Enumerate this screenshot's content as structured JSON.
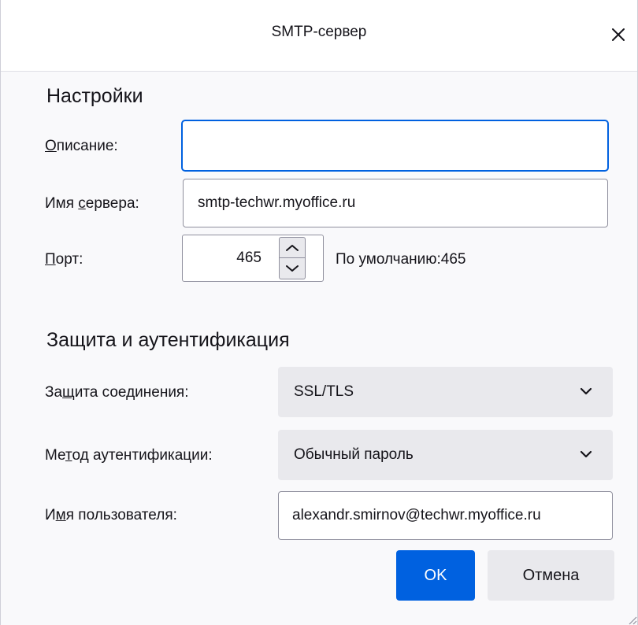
{
  "window": {
    "title": "SMTP-сервер"
  },
  "settings": {
    "section_title": "Настройки",
    "description": {
      "label_accel": "О",
      "label_rest": "писание:",
      "value": ""
    },
    "server_name": {
      "label_before": "Имя ",
      "label_accel": "с",
      "label_rest": "ервера:",
      "value": "smtp-techwr.myoffice.ru"
    },
    "port": {
      "label_accel": "П",
      "label_rest": "орт:",
      "value": "465",
      "default_text": "По умолчанию:465"
    }
  },
  "security": {
    "section_title": "Защита и аутентификация",
    "connection_security": {
      "label_before": "За",
      "label_accel": "щ",
      "label_rest": "ита соединения:",
      "selected": "SSL/TLS"
    },
    "auth_method": {
      "label_before": "Ме",
      "label_accel": "т",
      "label_rest": "од аутентификации:",
      "selected": "Обычный пароль"
    },
    "username": {
      "label_before": "И",
      "label_accel": "м",
      "label_rest": "я пользователя:",
      "value": "alexandr.smirnov@techwr.myoffice.ru"
    }
  },
  "buttons": {
    "ok": "OK",
    "cancel": "Отмена"
  },
  "colors": {
    "accent": "#0061e0",
    "button_bg": "#e9e9ed",
    "dialog_bg": "#f9f9fb"
  },
  "icons": {
    "close": "close-icon",
    "spin_up": "chevron-up-icon",
    "spin_down": "chevron-down-icon",
    "select": "chevron-down-icon",
    "resize": "resize-grip-icon"
  }
}
